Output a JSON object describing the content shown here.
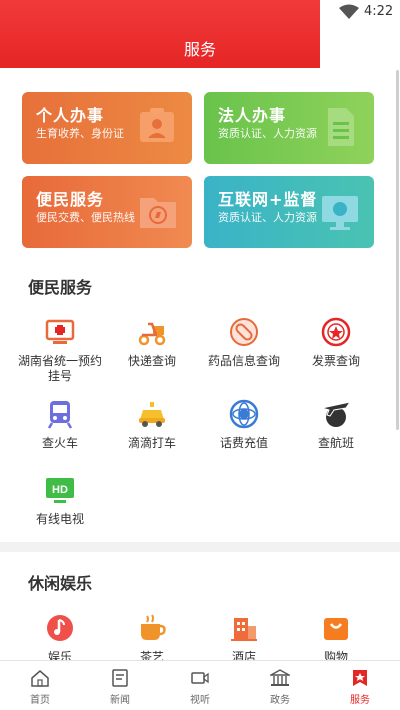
{
  "status": {
    "time": "4:22"
  },
  "header": {
    "title": "服务"
  },
  "cards": [
    {
      "title": "个人办事",
      "subtitle": "生育收养、身份证"
    },
    {
      "title": "法人办事",
      "subtitle": "资质认证、人力资源"
    },
    {
      "title": "便民服务",
      "subtitle": "便民交费、便民热线"
    },
    {
      "title": "互联网+监督",
      "subtitle": "资质认证、人力资源"
    }
  ],
  "sections": {
    "convenience": {
      "title": "便民服务",
      "items": [
        {
          "label": "湖南省统一预约挂号",
          "icon": "hospital-icon"
        },
        {
          "label": "快递查询",
          "icon": "delivery-scooter-icon"
        },
        {
          "label": "药品信息查询",
          "icon": "pill-icon"
        },
        {
          "label": "发票查询",
          "icon": "invoice-seal-icon"
        },
        {
          "label": "查火车",
          "icon": "train-icon"
        },
        {
          "label": "滴滴打车",
          "icon": "taxi-icon"
        },
        {
          "label": "话费充值",
          "icon": "phone-recharge-icon"
        },
        {
          "label": "查航班",
          "icon": "airplane-globe-icon"
        },
        {
          "label": "有线电视",
          "icon": "hd-tv-icon"
        }
      ]
    },
    "leisure": {
      "title": "休闲娱乐",
      "items": [
        {
          "label": "娱乐",
          "icon": "music-icon"
        },
        {
          "label": "茶艺",
          "icon": "tea-cup-icon"
        },
        {
          "label": "酒店",
          "icon": "hotel-icon"
        },
        {
          "label": "购物",
          "icon": "shopping-bag-icon"
        }
      ]
    }
  },
  "bottom_nav": [
    {
      "label": "首页",
      "icon": "home-icon"
    },
    {
      "label": "新闻",
      "icon": "news-icon"
    },
    {
      "label": "视听",
      "icon": "video-icon"
    },
    {
      "label": "政务",
      "icon": "government-icon"
    },
    {
      "label": "服务",
      "icon": "service-icon",
      "active": true
    }
  ],
  "colors": {
    "brand_red": "#e62525"
  }
}
